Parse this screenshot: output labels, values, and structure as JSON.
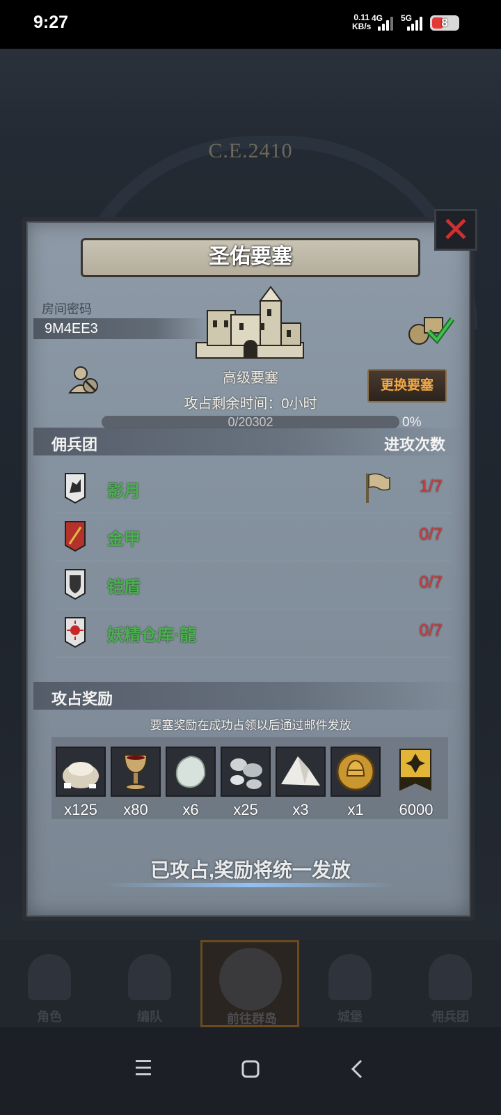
{
  "status_bar": {
    "time": "9:27",
    "speed_value": "0.11",
    "speed_unit": "KB/s",
    "network_1": "4G",
    "network_2": "5G",
    "battery": "8"
  },
  "background": {
    "era_label": "C.E.2410"
  },
  "dialog": {
    "title": "圣佑要塞",
    "room_label": "房间密码",
    "room_code": "9M4EE3",
    "fortress_type": "高级要塞",
    "time_left": "攻占剩余时间：0小时",
    "change_button": "更换要塞",
    "progress_text": "0/20302",
    "progress_value": 0,
    "progress_percent": "0%",
    "mercenary_header": "佣兵团",
    "attack_header": "进攻次数",
    "groups": [
      {
        "name": "影月",
        "count": "1/7",
        "banner": "wolf-banner-icon",
        "has_flag": true
      },
      {
        "name": "金甲",
        "count": "0/7",
        "banner": "sword-banner-icon",
        "has_flag": false
      },
      {
        "name": "铠盾",
        "count": "0/7",
        "banner": "shield-banner-icon",
        "has_flag": false
      },
      {
        "name": "妖精仓库·龍",
        "count": "0/7",
        "banner": "sun-banner-icon",
        "has_flag": false
      }
    ],
    "reward_header": "攻占奖励",
    "reward_note": "要塞奖励在成功占领以后通过邮件发放",
    "rewards": [
      {
        "qty": "x125",
        "icon": "flour-sack-icon"
      },
      {
        "qty": "x80",
        "icon": "goblet-icon"
      },
      {
        "qty": "x6",
        "icon": "white-stone-icon"
      },
      {
        "qty": "x25",
        "icon": "silver-ore-icon"
      },
      {
        "qty": "x3",
        "icon": "salt-pile-icon"
      },
      {
        "qty": "x1",
        "icon": "gold-helmet-coin-icon"
      },
      {
        "qty": "6000",
        "icon": "guild-banner-icon"
      }
    ],
    "status_message": "已攻占,奖励将统一发放"
  },
  "bottom_nav": [
    {
      "label": "角色",
      "active": false
    },
    {
      "label": "编队",
      "active": false
    },
    {
      "label": "前往群岛",
      "active": true
    },
    {
      "label": "城堡",
      "active": false
    },
    {
      "label": "佣兵团",
      "active": false
    }
  ],
  "colors": {
    "accent_green": "#4caf50",
    "count_red": "#d33a3a",
    "button_text": "#f0a848",
    "close_red": "#d32f2f"
  }
}
